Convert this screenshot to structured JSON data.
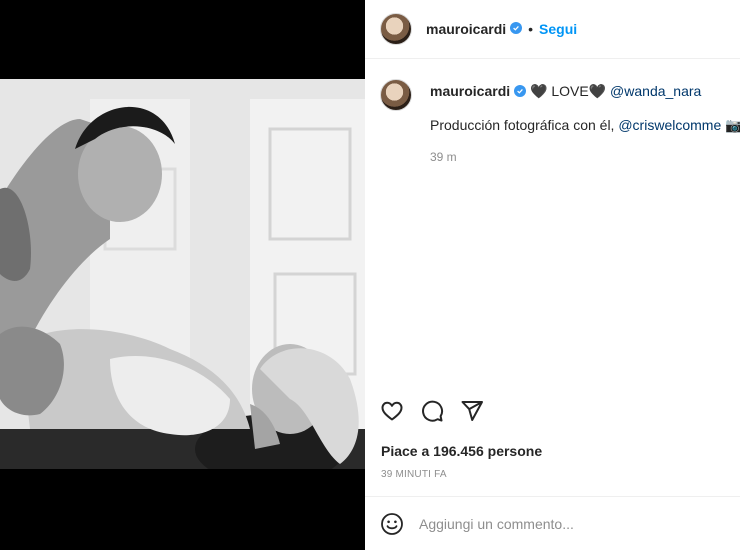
{
  "post": {
    "username": "mauroicardi",
    "verified": true,
    "follow_label": "Segui",
    "caption": {
      "heart_left": "🖤",
      "love_text": "LOVE",
      "heart_right": "🖤",
      "mention_primary": "@wanda_nara",
      "line2_text": "Producción fotográfica con él, ",
      "mention_secondary": "@criswelcomme",
      "camera_emoji": "📷",
      "relative_time": "39 m"
    },
    "likes_text": "Piace a 196.456 persone",
    "timestamp": "39 MINUTI FA",
    "comment_placeholder": "Aggiungi un commento..."
  },
  "icons": {
    "like": "heart-outline-icon",
    "comment": "comment-bubble-icon",
    "share": "paper-plane-icon",
    "emoji": "smiley-icon",
    "verified": "verified-badge-icon"
  },
  "colors": {
    "follow": "#0095f6",
    "verified": "#3897f0",
    "mention": "#00376b",
    "muted": "#8e8e8e",
    "text": "#262626"
  }
}
